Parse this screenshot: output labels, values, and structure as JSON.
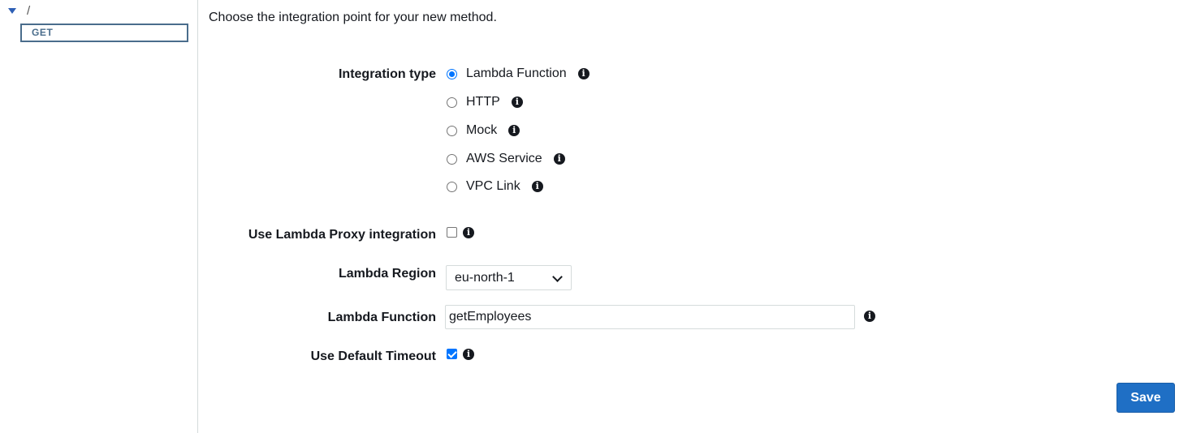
{
  "tree": {
    "root_path": "/",
    "method": "GET"
  },
  "intro_text": "Choose the integration point for your new method.",
  "integration_type": {
    "label": "Integration type",
    "options": [
      {
        "label": "Lambda Function",
        "selected": true
      },
      {
        "label": "HTTP",
        "selected": false
      },
      {
        "label": "Mock",
        "selected": false
      },
      {
        "label": "AWS Service",
        "selected": false
      },
      {
        "label": "VPC Link",
        "selected": false
      }
    ]
  },
  "proxy": {
    "label": "Use Lambda Proxy integration",
    "checked": false
  },
  "region": {
    "label": "Lambda Region",
    "value": "eu-north-1"
  },
  "function": {
    "label": "Lambda Function",
    "value": "getEmployees"
  },
  "timeout": {
    "label": "Use Default Timeout",
    "checked": true
  },
  "save_label": "Save",
  "colors": {
    "accent": "#0075ff",
    "button": "#1f6fc5",
    "tree_method": "#4a6d8c"
  },
  "icons": {
    "info": "info-circle-icon",
    "caret": "caret-down-icon",
    "select": "chevron-down-icon"
  }
}
